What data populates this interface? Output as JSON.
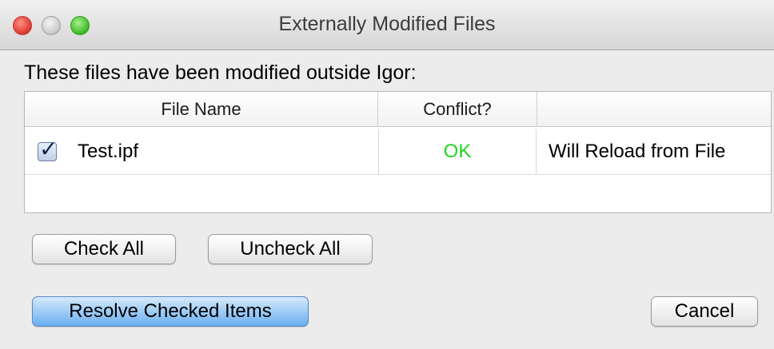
{
  "window": {
    "title": "Externally Modified Files"
  },
  "dialog": {
    "prompt": "These files have been modified outside Igor:",
    "table": {
      "columns": [
        "File Name",
        "Conflict?",
        ""
      ],
      "rows": [
        {
          "checked": true,
          "file_name": "Test.ipf",
          "conflict": "OK",
          "action": "Will Reload from File"
        }
      ]
    },
    "buttons": {
      "check_all": "Check All",
      "uncheck_all": "Uncheck All",
      "resolve": "Resolve Checked Items",
      "cancel": "Cancel"
    }
  },
  "colors": {
    "conflict_ok": "#1fd51f",
    "default_button": "#7fbaf3"
  }
}
